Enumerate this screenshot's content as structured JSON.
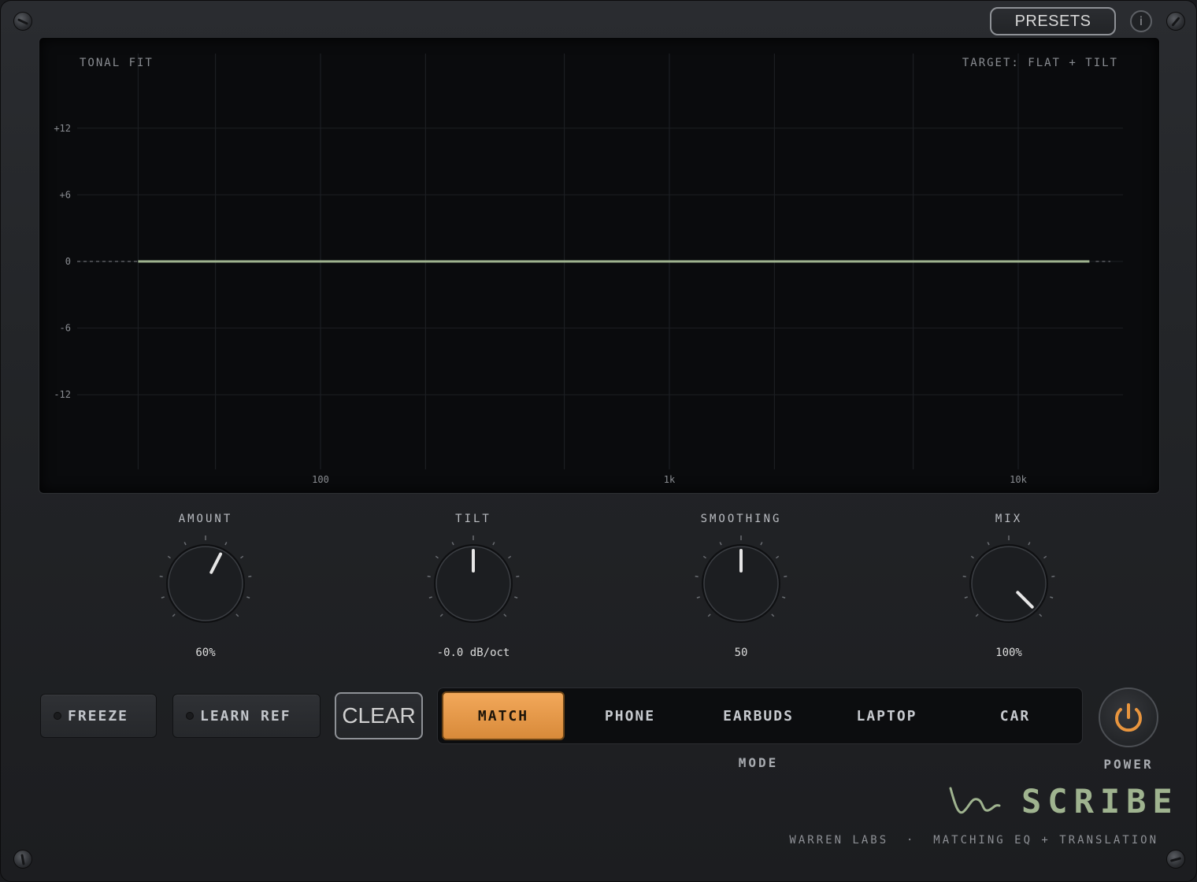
{
  "header": {
    "presets_label": "PRESETS",
    "info_icon": "info-icon",
    "edit_icon": "pencil-icon"
  },
  "display": {
    "title": "TONAL FIT",
    "target_label": "TARGET: FLAT + TILT",
    "y_ticks": [
      "+12",
      "+6",
      "0",
      "-6",
      "-12"
    ],
    "x_ticks": [
      "100",
      "1k",
      "10k"
    ],
    "curve_color": "#9fb38f"
  },
  "chart_data": {
    "type": "line",
    "title": "TONAL FIT",
    "xlabel": "",
    "ylabel": "",
    "x_scale": "log",
    "x_tick_labels": [
      "100",
      "1k",
      "10k"
    ],
    "y_tick_labels": [
      "+12",
      "+6",
      "0",
      "-6",
      "-12"
    ],
    "ylim": [
      -18,
      18
    ],
    "series": [
      {
        "x": [
          30,
          100,
          1000,
          10000,
          16000
        ],
        "y": [
          0,
          0,
          0,
          0,
          0
        ]
      }
    ],
    "grid": true
  },
  "knobs": [
    {
      "label": "AMOUNT",
      "value": "60%",
      "fraction": 0.6
    },
    {
      "label": "TILT",
      "value": "-0.0 dB/oct",
      "fraction": 0.5
    },
    {
      "label": "SMOOTHING",
      "value": "50",
      "fraction": 0.5
    },
    {
      "label": "MIX",
      "value": "100%",
      "fraction": 1.0
    }
  ],
  "buttons": {
    "freeze": "FREEZE",
    "learn_ref": "LEARN REF",
    "clear": "CLEAR"
  },
  "mode": {
    "caption": "MODE",
    "options": [
      "MATCH",
      "PHONE",
      "EARBUDS",
      "LAPTOP",
      "CAR"
    ],
    "selected": "MATCH"
  },
  "power": {
    "caption": "POWER",
    "accent": "#e8953e"
  },
  "brand": {
    "name": "SCRIBE",
    "subtitle": "WARREN LABS  ·  MATCHING EQ + TRANSLATION",
    "logo_icon": "waveform-logo-icon"
  },
  "colors": {
    "accent": "#e8953e",
    "brand": "#9fb38f"
  }
}
